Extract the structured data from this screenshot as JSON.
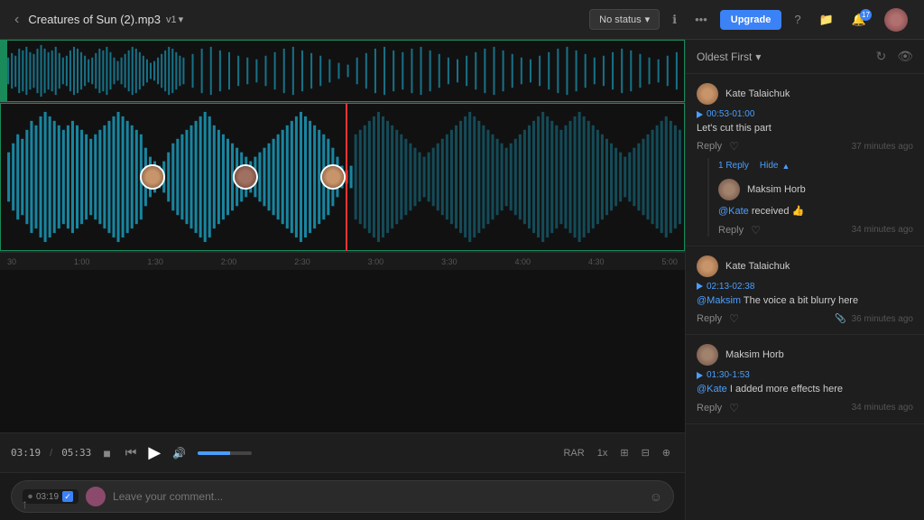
{
  "topbar": {
    "back_label": "‹",
    "file_title": "Creatures of Sun (2).mp3",
    "version": "v1",
    "version_arrow": "▾",
    "status_label": "No status",
    "status_arrow": "▾",
    "info_icon": "ℹ",
    "more_icon": "•••",
    "upgrade_label": "Upgrade",
    "help_icon": "?",
    "folder_icon": "📁",
    "notif_icon": "🔔",
    "notif_count": "17"
  },
  "player": {
    "current_time": "03:19",
    "total_time": "05:33",
    "stop_icon": "■",
    "rewind_icon": "⏮",
    "play_icon": "▶",
    "volume_icon": "🔊",
    "rar_label": "RAR",
    "speed_label": "1x"
  },
  "comment_input": {
    "timestamp": "03:19",
    "placeholder": "Leave your comment...",
    "emoji_icon": "☺"
  },
  "comments": {
    "sort_label": "Oldest First",
    "sort_arrow": "▾",
    "sort_icon": "↻",
    "eye_icon": "👁",
    "items": [
      {
        "user": "Kate Talaichuk",
        "avatar_type": "kate",
        "timestamp_range": "00:53-01:00",
        "text": "Let's cut this part",
        "reply_label": "Reply",
        "like_icon": "♡",
        "age": "37 minutes ago",
        "replies_count": "1 Reply",
        "replies_action": "Hide",
        "replies_arrow": "▲",
        "replies": [
          {
            "user": "Maksim Horb",
            "avatar_type": "maksim",
            "mention": "@Kate",
            "text": " received 👍",
            "reply_label": "Reply",
            "like_icon": "♡",
            "age": "34 minutes ago"
          }
        ]
      },
      {
        "user": "Kate Talaichuk",
        "avatar_type": "kate",
        "timestamp_range": "02:13-02:38",
        "mention": "@Maksim",
        "text": " The voice a bit blurry here",
        "reply_label": "Reply",
        "like_icon": "♡",
        "attach_icon": "📎",
        "age": "36 minutes ago",
        "replies": []
      },
      {
        "user": "Maksim Horb",
        "avatar_type": "maksim",
        "timestamp_range": "01:30-1:53",
        "mention": "@Kate",
        "text": " I added more effects here",
        "reply_label": "Reply",
        "like_icon": "♡",
        "age": "34 minutes ago",
        "replies": []
      }
    ]
  },
  "timeline": {
    "marks": [
      "30",
      "1:00",
      "1:30",
      "2:00",
      "2:30",
      "3:00",
      "3:30",
      "4:00",
      "4:30",
      "5:00"
    ]
  },
  "bottom_arrow": "↑"
}
